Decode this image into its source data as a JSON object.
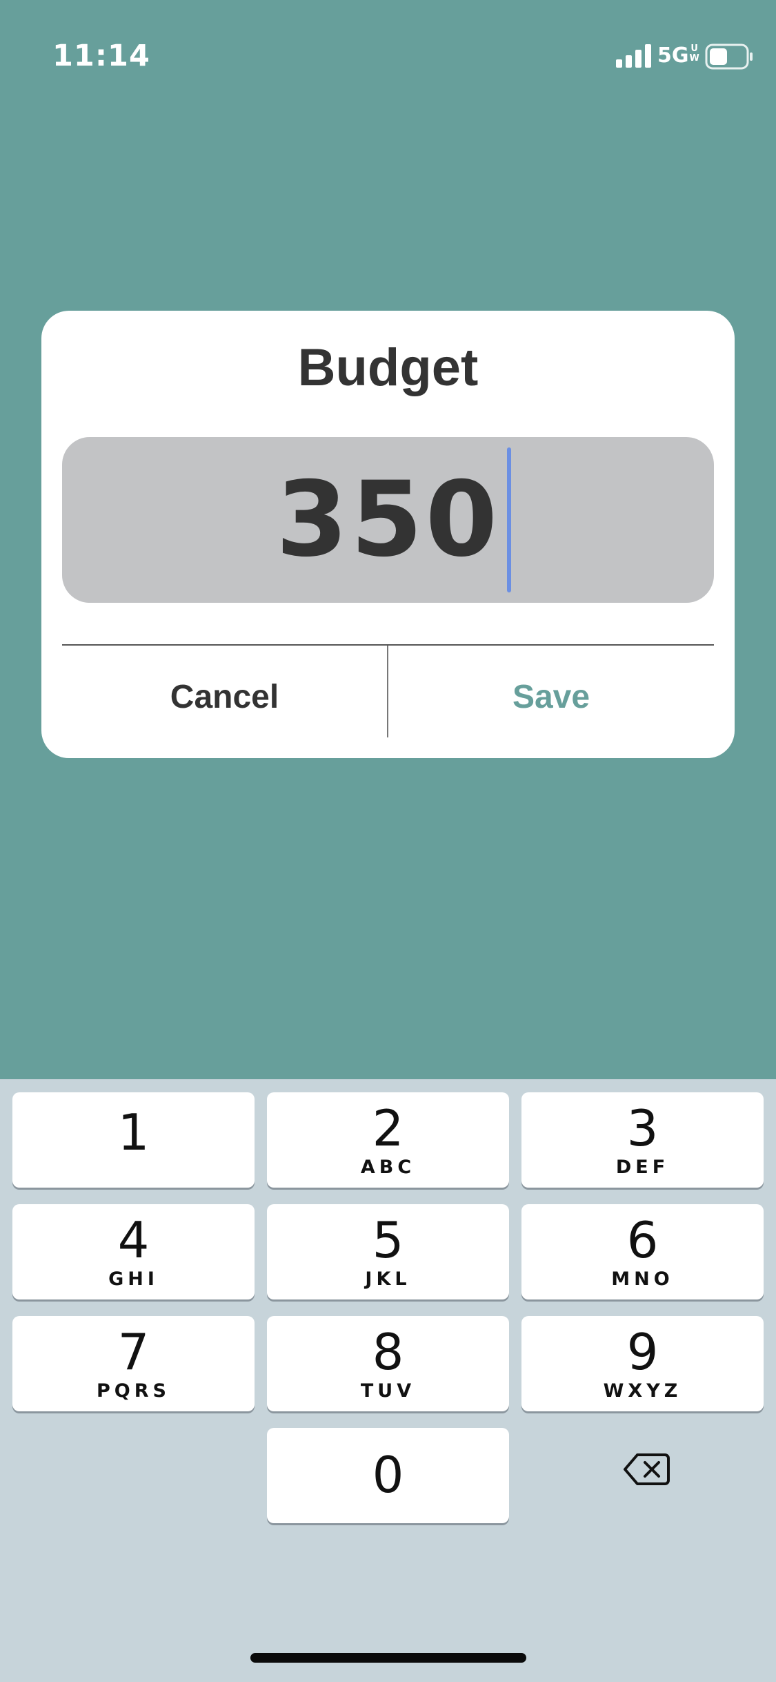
{
  "status_bar": {
    "time": "11:14",
    "network": "5G",
    "network_suffix_top": "U",
    "network_suffix_bottom": "W",
    "battery_level": 0.5
  },
  "dialog": {
    "title": "Budget",
    "amount_value": "350",
    "cancel_label": "Cancel",
    "save_label": "Save",
    "accent_color": "#679f9b"
  },
  "keypad": {
    "keys": [
      {
        "digit": "1",
        "letters": ""
      },
      {
        "digit": "2",
        "letters": "ABC"
      },
      {
        "digit": "3",
        "letters": "DEF"
      },
      {
        "digit": "4",
        "letters": "GHI"
      },
      {
        "digit": "5",
        "letters": "JKL"
      },
      {
        "digit": "6",
        "letters": "MNO"
      },
      {
        "digit": "7",
        "letters": "PQRS"
      },
      {
        "digit": "8",
        "letters": "TUV"
      },
      {
        "digit": "9",
        "letters": "WXYZ"
      },
      {
        "digit": "0",
        "letters": ""
      }
    ],
    "delete_icon": "backspace-icon"
  },
  "colors": {
    "background": "#679f9b",
    "keyboard_background": "#c7d4da",
    "cursor": "#6b8fe3"
  }
}
